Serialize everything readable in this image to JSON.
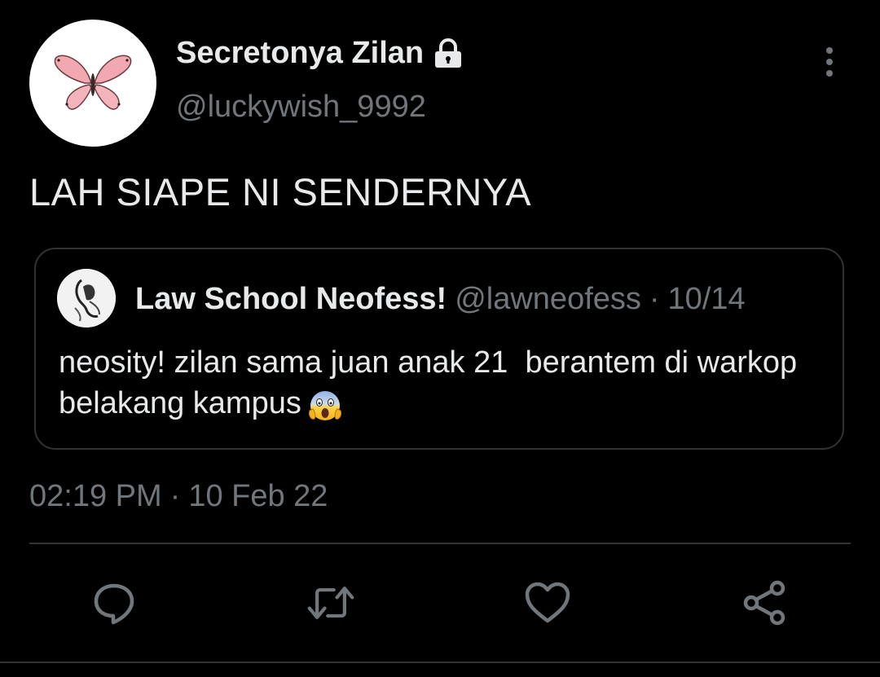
{
  "author": {
    "display_name": "Secretonya Zilan",
    "handle": "@luckywish_9992",
    "avatar_icon": "butterfly-icon",
    "protected_icon": "lock-icon"
  },
  "tweet": {
    "text": "LAH SIAPE NI SENDERNYA"
  },
  "quote": {
    "name": "Law School Neofess!",
    "handle": "@lawneofess",
    "separator": "·",
    "date": "10/14",
    "text": "neosity! zilan sama juan anak 21  berantem di warkop belakang kampus",
    "emoji": "face-screaming-in-fear-icon"
  },
  "meta": {
    "time": "02:19 PM",
    "separator": "·",
    "date": "10 Feb 22"
  },
  "actions": [
    "reply-icon",
    "retweet-icon",
    "like-icon",
    "share-icon"
  ],
  "colors": {
    "background": "#000000",
    "text_primary": "#e7e9ea",
    "text_secondary": "#71767b",
    "border": "#2f3336"
  }
}
